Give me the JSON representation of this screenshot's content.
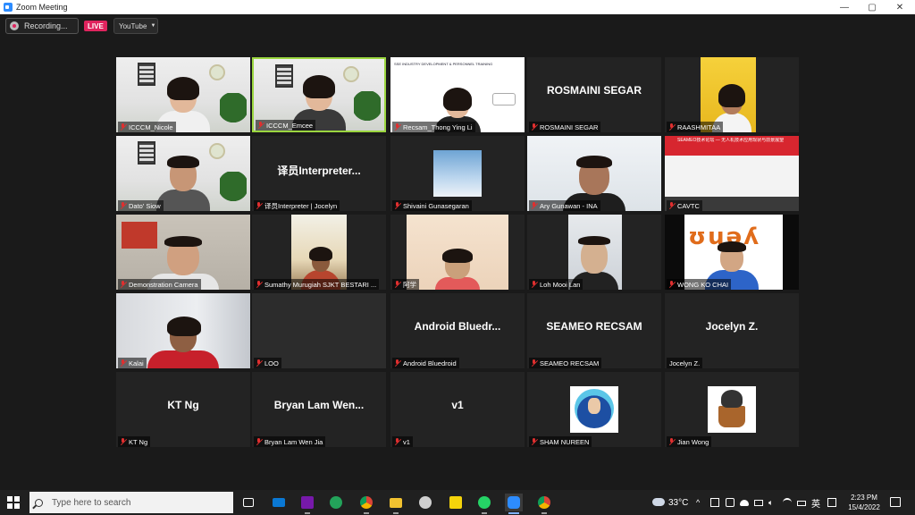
{
  "window": {
    "title": "Zoom Meeting",
    "controls": [
      "—",
      "▢",
      "✕"
    ]
  },
  "topbar": {
    "recording_label": "Recording...",
    "live_label": "LIVE",
    "stream_label": "YouTube"
  },
  "tiles": [
    {
      "name": "ICCCM_Nicole",
      "muted": true
    },
    {
      "name": "ICCCM_Emcee",
      "muted": true,
      "active": true
    },
    {
      "name": "Recsam_Thong Ying Li",
      "muted": true,
      "overlay": "SSE INDUSTRY DEVELOPMENT & PERSONNEL TRAINING"
    },
    {
      "name": "ROSMAINI SEGAR",
      "muted": true,
      "big_name": "ROSMAINI SEGAR"
    },
    {
      "name": "RAASHMITAA",
      "muted": true
    },
    {
      "name": "Dato' Siow",
      "muted": true
    },
    {
      "name": "译员Interpreter | Jocelyn",
      "muted": true,
      "big_name": "译员Interpreter..."
    },
    {
      "name": "Shivaini Gunasegaran",
      "muted": true
    },
    {
      "name": "Ary Gunawan - INA",
      "muted": true
    },
    {
      "name": "CAVTC",
      "muted": true,
      "overlay": "SEAMEO技术论坛 — 无人机技术应用现状与前景展望"
    },
    {
      "name": "Demonstration Camera",
      "muted": true
    },
    {
      "name": "Sumathy Murugiah SJKT BESTARI ...",
      "muted": true
    },
    {
      "name": "阿学",
      "muted": true
    },
    {
      "name": "Loh Mooi Lan",
      "muted": true
    },
    {
      "name": "WONG KO CHAI",
      "muted": true
    },
    {
      "name": "Kalai",
      "muted": true
    },
    {
      "name": "LOO",
      "muted": true
    },
    {
      "name": "Android Bluedroid",
      "muted": true,
      "big_name": "Android Bluedr..."
    },
    {
      "name": "SEAMEO RECSAM",
      "muted": true,
      "big_name": "SEAMEO RECSAM"
    },
    {
      "name": "Jocelyn Z.",
      "muted": false,
      "big_name": "Jocelyn Z."
    },
    {
      "name": "KT Ng",
      "muted": true,
      "big_name": "KT Ng"
    },
    {
      "name": "Bryan Lam Wen Jia",
      "muted": true,
      "big_name": "Bryan Lam Wen..."
    },
    {
      "name": "v1",
      "muted": true,
      "big_name": "v1"
    },
    {
      "name": "SHAM NUREEN",
      "muted": true
    },
    {
      "name": "Jian Wong",
      "muted": true
    }
  ],
  "taskbar": {
    "search_placeholder": "Type here to search",
    "weather": "33°C",
    "ime": "英",
    "time": "2:23 PM",
    "date": "15/4/2022"
  },
  "colors": {
    "active_border": "#9bd63f",
    "live_red": "#e0245e",
    "muted_red": "#e02f2f",
    "zoom_blue": "#2d8cff"
  }
}
